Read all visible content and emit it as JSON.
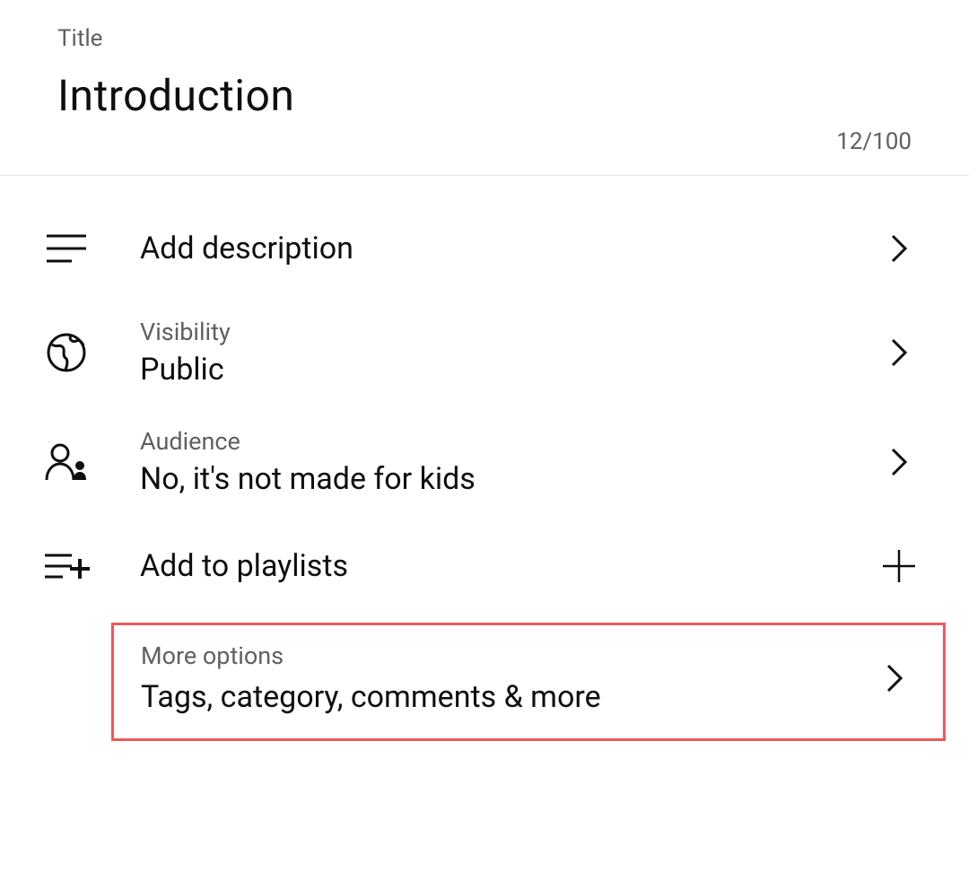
{
  "title_section": {
    "label": "Title",
    "value": "Introduction",
    "char_count": "12/100"
  },
  "rows": {
    "description": {
      "label": "Add description"
    },
    "visibility": {
      "sub_label": "Visibility",
      "value": "Public"
    },
    "audience": {
      "sub_label": "Audience",
      "value": "No, it's not made for kids"
    },
    "playlists": {
      "label": "Add to playlists"
    },
    "more": {
      "sub_label": "More options",
      "value": "Tags, category, comments & more"
    }
  }
}
